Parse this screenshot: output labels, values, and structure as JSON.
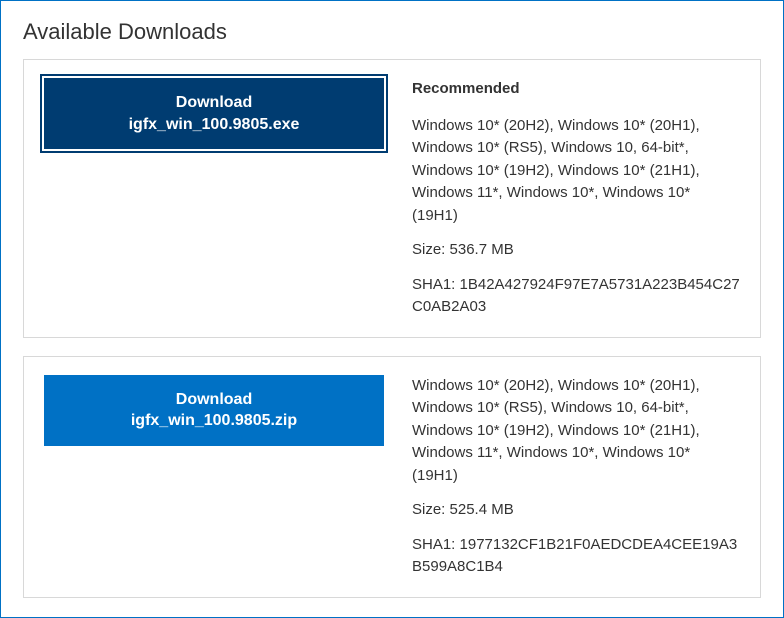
{
  "section_title": "Available Downloads",
  "downloads": [
    {
      "button_label": "Download",
      "filename": "igfx_win_100.9805.exe",
      "recommended": "Recommended",
      "os_list": "Windows 10* (20H2), Windows 10* (20H1), Windows 10* (RS5), Windows 10, 64-bit*, Windows 10* (19H2), Windows 10* (21H1), Windows 11*, Windows 10*, Windows 10* (19H1)",
      "size": "Size: 536.7 MB",
      "sha1": "SHA1: 1B42A427924F97E7A5731A223B454C27C0AB2A03"
    },
    {
      "button_label": "Download",
      "filename": "igfx_win_100.9805.zip",
      "recommended": "",
      "os_list": "Windows 10* (20H2), Windows 10* (20H1), Windows 10* (RS5), Windows 10, 64-bit*, Windows 10* (19H2), Windows 10* (21H1), Windows 11*, Windows 10*, Windows 10* (19H1)",
      "size": "Size: 525.4 MB",
      "sha1": "SHA1: 1977132CF1B21F0AEDCDEA4CEE19A3B599A8C1B4"
    }
  ]
}
